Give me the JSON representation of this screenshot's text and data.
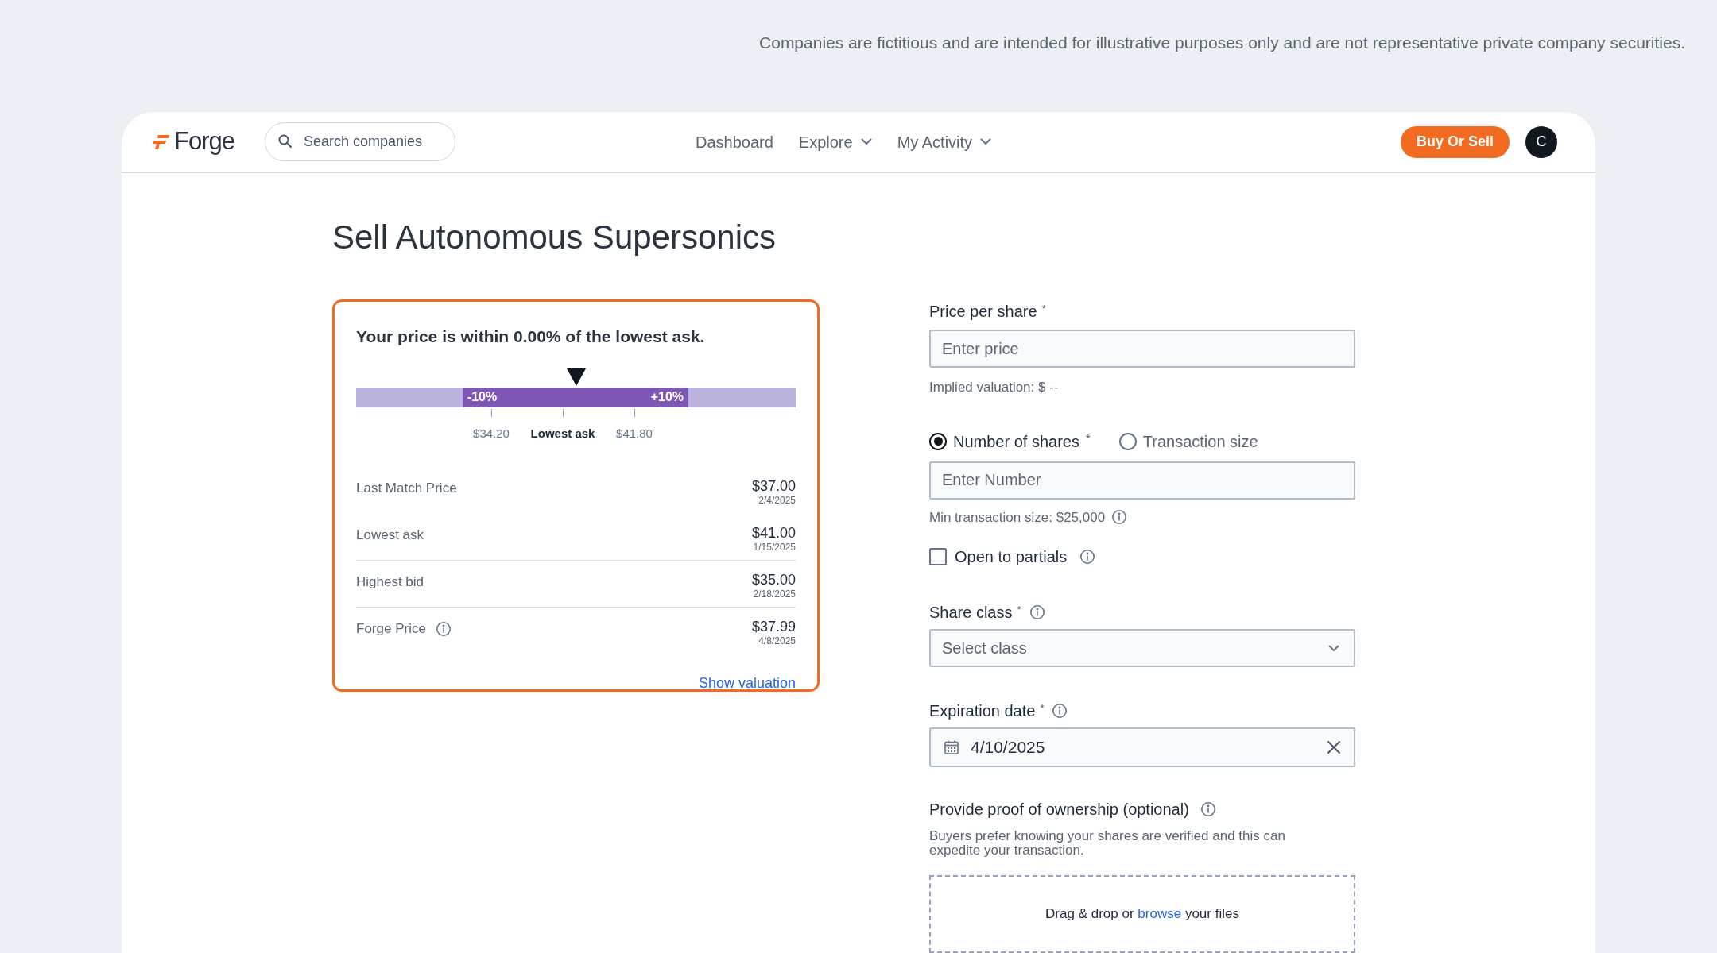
{
  "disclaimer": "Companies are fictitious and are intended for illustrative purposes only and are not representative private company securities.",
  "header": {
    "logo": "Forge",
    "search": {
      "placeholder": "Search companies"
    },
    "nav": [
      {
        "label": "Dashboard",
        "dropdown": false
      },
      {
        "label": "Explore",
        "dropdown": true
      },
      {
        "label": "My Activity",
        "dropdown": true
      }
    ],
    "action": "Buy Or Sell",
    "avatar": "C"
  },
  "title": "Sell Autonomous Supersonics",
  "price_card": {
    "headline": "Your price is within 0.00% of the lowest ask.",
    "pointer": {
      "level": 0.5
    },
    "band": {
      "low": "-10%",
      "high": "+10%"
    },
    "ticks": [
      {
        "label": "$34.20",
        "bold": false
      },
      {
        "label": "Lowest ask",
        "bold": true
      },
      {
        "label": "$41.80",
        "bold": false
      }
    ],
    "stats": [
      {
        "label": "Last Match Price",
        "info": false,
        "value": "$37.00",
        "date": "2/4/2025",
        "divider_above": false
      },
      {
        "label": "Lowest ask",
        "info": false,
        "value": "$41.00",
        "date": "1/15/2025",
        "divider_above": false
      },
      {
        "label": "Highest bid",
        "info": false,
        "value": "$35.00",
        "date": "2/18/2025",
        "divider_above": true
      },
      {
        "label": "Forge Price",
        "info": true,
        "value": "$37.99",
        "date": "4/8/2025",
        "divider_above": true
      }
    ],
    "link": "Show valuation"
  },
  "form": {
    "price": {
      "label": "Price per share",
      "required_mark": "*",
      "placeholder": "Enter price",
      "hint": "Implied valuation: $ --"
    },
    "mode_options": [
      {
        "label": "Number of shares",
        "required_mark": "*",
        "selected": true
      },
      {
        "label": "Transaction size",
        "selected": false
      }
    ],
    "quantity": {
      "placeholder": "Enter Number",
      "hint": "Min transaction size: $25,000"
    },
    "partials": {
      "label": "Open to partials",
      "checked": false
    },
    "share_class": {
      "label": "Share class",
      "required_mark": "*",
      "placeholder": "Select class"
    },
    "expiration": {
      "label": "Expiration date",
      "required_mark": "*",
      "value": "4/10/2025"
    },
    "proof": {
      "label": "Provide proof of ownership (optional)",
      "description": "Buyers prefer knowing your shares are verified and this can expedite your transaction.",
      "drop_before": "Drag & drop or",
      "drop_link": "browse",
      "drop_after": "your files"
    }
  }
}
